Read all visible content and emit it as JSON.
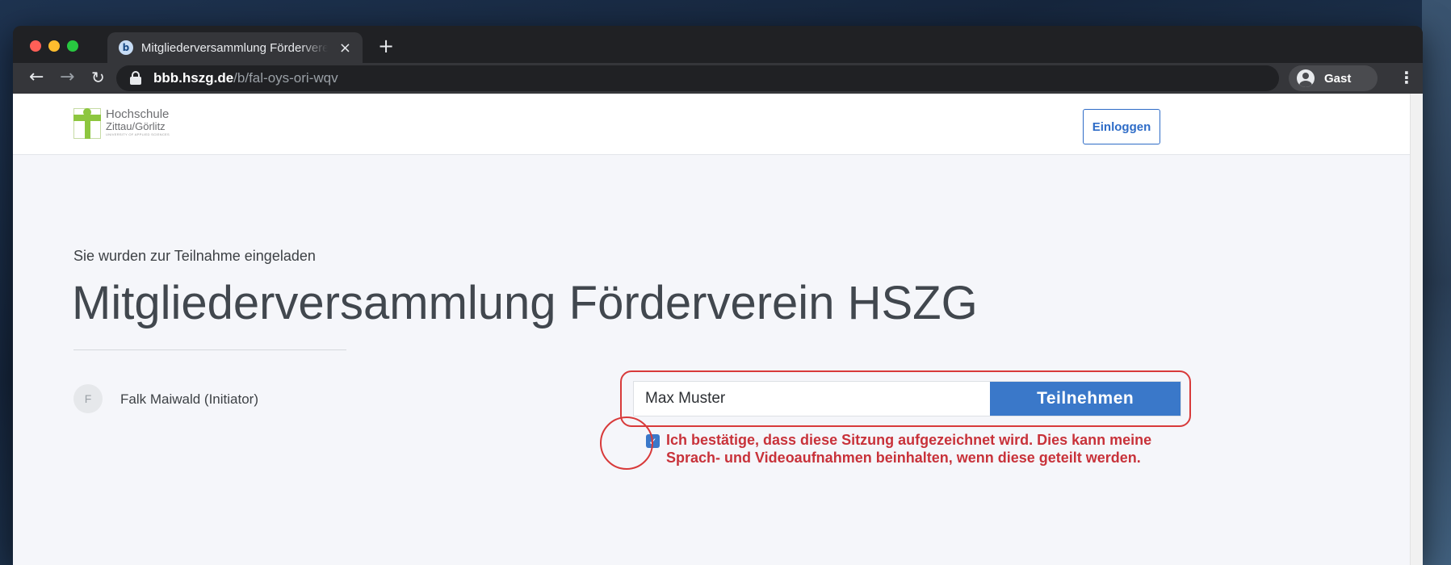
{
  "browser": {
    "tab_title": "Mitgliederversammlung Förderverein HSZG",
    "tab_close": "×",
    "new_tab": "+",
    "favicon_letter": "b",
    "url_host": "bbb.hszg.de",
    "url_path": "/b/fal-oys-ori-wqv",
    "profile_name": "Gast",
    "icons": [
      "back-arrow-icon",
      "forward-arrow-icon",
      "reload-icon",
      "lock-icon",
      "profile-icon",
      "kebab-menu-icon"
    ]
  },
  "header": {
    "logo_line1": "Hochschule",
    "logo_line2": "Zittau/Görlitz",
    "logo_line3": "UNIVERSITY OF APPLIED SCIENCES",
    "login_label": "Einloggen"
  },
  "main": {
    "invite_label": "Sie wurden zur Teilnahme eingeladen",
    "room_title": "Mitgliederversammlung Förderverein HSZG",
    "owner_initial": "F",
    "owner_name": "Falk Maiwald (Initiator)",
    "name_input_value": "Max Muster",
    "join_label": "Teilnehmen",
    "consent_checked": true,
    "consent_text": "Ich bestätige, dass diese Sitzung aufgezeichnet wird. Dies kann meine Sprach- und Videoaufnahmen beinhalten, wenn diese geteilt werden."
  },
  "colors": {
    "accent": "#3a78c9",
    "consent_text": "#c8323a",
    "annotation": "#d83a3a"
  }
}
